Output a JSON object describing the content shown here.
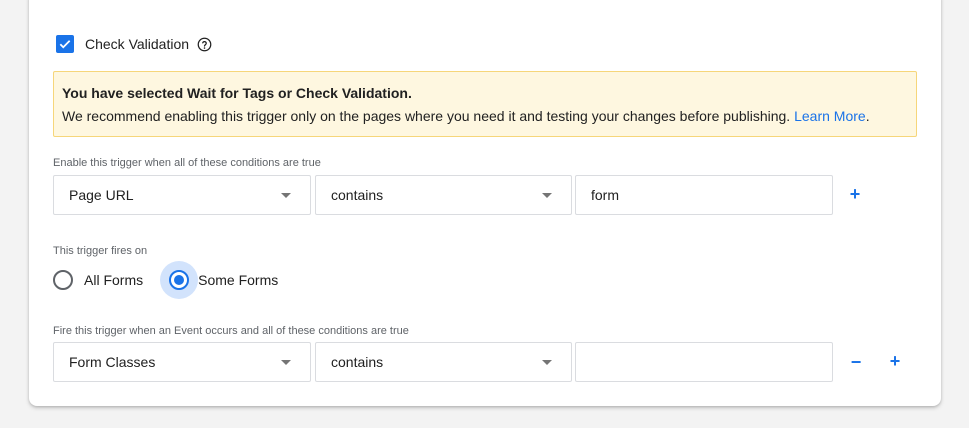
{
  "check_validation": {
    "label": "Check Validation",
    "checked": true,
    "help_icon": "help-circle-icon"
  },
  "notice": {
    "title": "You have selected Wait for Tags or Check Validation.",
    "text": "We recommend enabling this trigger only on the pages where you need it and testing your changes before publishing.",
    "link": "Learn More",
    "after_link": "."
  },
  "enable_conditions": {
    "label": "Enable this trigger when all of these conditions are true",
    "variable": "Page URL",
    "operator": "contains",
    "value": "form",
    "add_label": "+"
  },
  "fires_on": {
    "label": "This trigger fires on",
    "options": [
      {
        "label": "All Forms",
        "selected": false
      },
      {
        "label": "Some Forms",
        "selected": true
      }
    ]
  },
  "fire_conditions": {
    "label": "Fire this trigger when an Event occurs and all of these conditions are true",
    "variable": "Form Classes",
    "operator": "contains",
    "value": "",
    "remove_label": "−",
    "add_label": "+"
  },
  "colors": {
    "accent": "#1a73e8",
    "notice_bg": "#fef7e0",
    "notice_border": "#f6d67a"
  }
}
